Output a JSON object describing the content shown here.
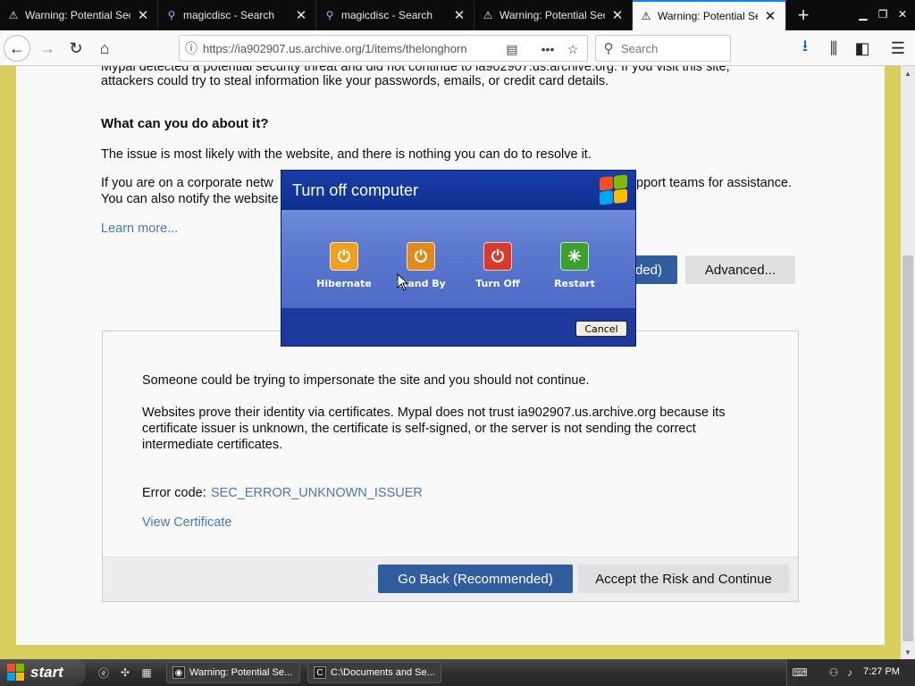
{
  "browser": {
    "tabs": [
      {
        "label": "Warning: Potential Security Risk Ahead",
        "icon": "warning-icon",
        "active": false
      },
      {
        "label": "magicdisc - Search",
        "icon": "search-icon",
        "active": false
      },
      {
        "label": "magicdisc - Search",
        "icon": "search-icon",
        "active": false
      },
      {
        "label": "Warning: Potential Security Risk Ahead",
        "icon": "warning-icon",
        "active": false
      },
      {
        "label": "Warning: Potential Security Risk Ahead",
        "icon": "warning-icon",
        "active": true
      }
    ],
    "url": "https://ia902907.us.archive.org/1/items/thelonghorn",
    "search_placeholder": "Search"
  },
  "page": {
    "intro_line1": "Mypal detected a potential security threat and did not continue to ia902907.us.archive.org. If you visit this site,",
    "intro_line2": "attackers could try to steal information like your passwords, emails, or credit card details.",
    "heading": "What can you do about it?",
    "para1": "The issue is most likely with the website, and there is nothing you can do to resolve it.",
    "para2_line1_a": "If you are on a corporate netw",
    "para2_line1_b": "pport teams for assistance.",
    "para2_line2": "You can also notify the website",
    "learn_more": "Learn more...",
    "go_back_partial": "ded)",
    "advanced": "Advanced...",
    "adv_line1": "Someone could be trying to impersonate the site and you should not continue.",
    "adv_para_line1": "Websites prove their identity via certificates. Mypal does not trust ia902907.us.archive.org because its",
    "adv_para_line2": "certificate issuer is unknown, the certificate is self-signed, or the server is not sending the correct",
    "adv_para_line3": "intermediate certificates.",
    "error_code_label": "Error code:",
    "error_code": "SEC_ERROR_UNKNOWN_ISSUER",
    "view_certificate": "View Certificate",
    "go_back": "Go Back (Recommended)",
    "accept_risk": "Accept the Risk and Continue"
  },
  "dialog": {
    "title": "Turn off computer",
    "options": [
      {
        "label": "Hibernate",
        "icon": "hibernate-icon",
        "color": "#f0a020"
      },
      {
        "label": "Stand By",
        "icon": "standby-icon",
        "color": "#e08a1c"
      },
      {
        "label": "Turn Off",
        "icon": "power-icon",
        "color": "#d83b2a"
      },
      {
        "label": "Restart",
        "icon": "restart-icon",
        "color": "#3fa032"
      }
    ],
    "cancel": "Cancel"
  },
  "taskbar": {
    "start": "start",
    "tasks": [
      {
        "label": "Warning: Potential Se...",
        "icon": "firefox-icon"
      },
      {
        "label": "C:\\Documents and Se...",
        "icon": "cmd-icon"
      }
    ],
    "clock": "7:27 PM"
  },
  "colors": {
    "accent_blue": "#2f5d9e",
    "link": "#4a78b5",
    "page_bg": "#d8cf5e"
  }
}
